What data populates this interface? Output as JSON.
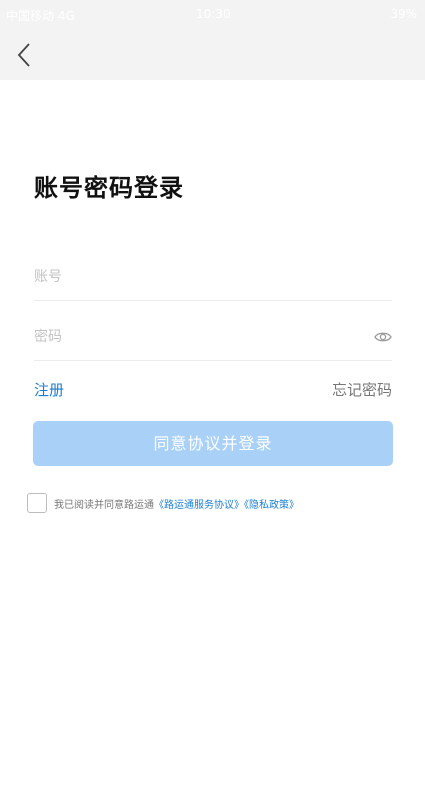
{
  "status_bar": {
    "carrier": "中国移动 4G",
    "time": "10:30",
    "indicators": "39%"
  },
  "nav": {
    "back_icon": "chevron-left-icon"
  },
  "login": {
    "title": "账号密码登录",
    "account_placeholder": "账号",
    "password_placeholder": "密码",
    "eye_icon": "eye-icon",
    "register_label": "注册",
    "forgot_label": "忘记密码",
    "submit_label": "同意协议并登录",
    "agreement_prefix": "我已阅读并同意路运通",
    "service_agreement": "《路运通服务协议》",
    "privacy_policy": "《隐私政策》"
  },
  "colors": {
    "accent": "#1b7fd0",
    "button_disabled": "#a9d1f7",
    "header_bg": "#f3f3f3"
  }
}
